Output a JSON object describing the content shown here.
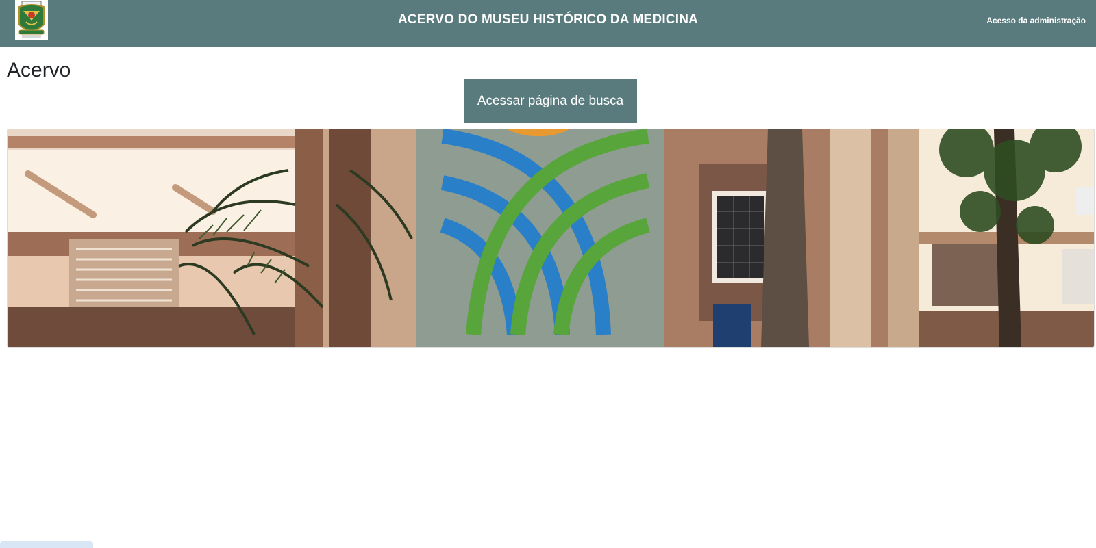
{
  "header": {
    "title": "ACERVO DO MUSEU HISTÓRICO DA MEDICINA",
    "admin_link": "Acesso da administração",
    "background_color": "#5a7b7d",
    "logo_icon": "coat-of-arms-icon"
  },
  "main": {
    "heading": "Acervo",
    "search_button_label": "Acessar página de busca",
    "banner_image": "museum-building-photo"
  }
}
